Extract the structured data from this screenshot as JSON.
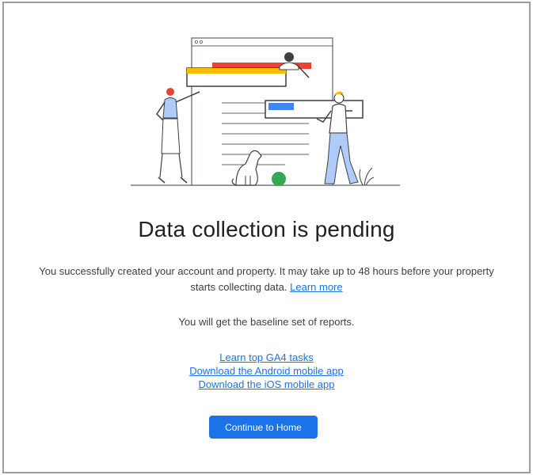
{
  "title": "Data collection is pending",
  "description": {
    "text": "You successfully created your account and property. It may take up to 48 hours before your property starts collecting data.",
    "learn_more": "Learn more"
  },
  "baseline_text": "You will get the baseline set of reports.",
  "links": [
    "Learn top GA4 tasks",
    "Download the Android mobile app",
    "Download the iOS mobile app"
  ],
  "continue_button": "Continue to Home",
  "colors": {
    "accent": "#1a73e8",
    "title": "#202124",
    "body_text": "#3c4043",
    "illus_red": "#ea4335",
    "illus_yellow": "#fbbc04",
    "illus_blue": "#4285f4",
    "illus_green": "#34a853",
    "illus_light_blue": "#aecbfa"
  },
  "illustration_icon": "people-building-webpage-illustration"
}
